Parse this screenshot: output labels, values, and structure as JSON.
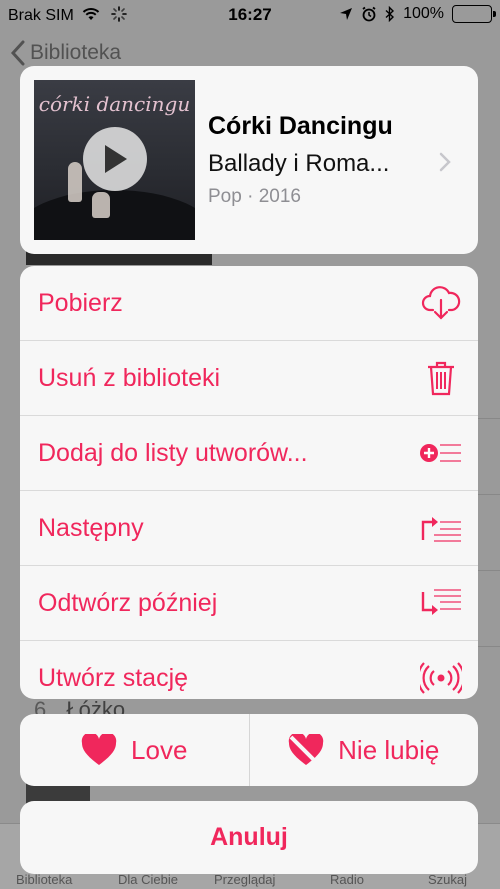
{
  "status_bar": {
    "carrier": "Brak SIM",
    "time": "16:27",
    "battery": "100%"
  },
  "nav": {
    "back_label": "Biblioteka"
  },
  "background": {
    "track_number": "6.",
    "track_title": "Łóżko",
    "tabs": [
      "Biblioteka",
      "Dla Ciebie",
      "Przeglądaj",
      "Radio",
      "Szukaj"
    ]
  },
  "album": {
    "cover_title": "córki dancingu",
    "title": "Córki Dancingu",
    "subtitle": "Ballady i Roma...",
    "meta": "Pop · 2016"
  },
  "actions": [
    {
      "label": "Pobierz",
      "icon": "download-cloud-icon"
    },
    {
      "label": "Usuń z biblioteki",
      "icon": "trash-icon"
    },
    {
      "label": "Dodaj do listy utworów...",
      "icon": "add-to-playlist-icon"
    },
    {
      "label": "Następny",
      "icon": "play-next-icon"
    },
    {
      "label": "Odtwórz później",
      "icon": "play-later-icon"
    },
    {
      "label": "Utwórz stację",
      "icon": "radio-station-icon"
    }
  ],
  "love": {
    "love_label": "Love",
    "dislike_label": "Nie lubię"
  },
  "cancel_label": "Anuluj",
  "colors": {
    "accent": "#f0275c",
    "sheet": "#f7f7f7",
    "battery": "#4cd964"
  }
}
